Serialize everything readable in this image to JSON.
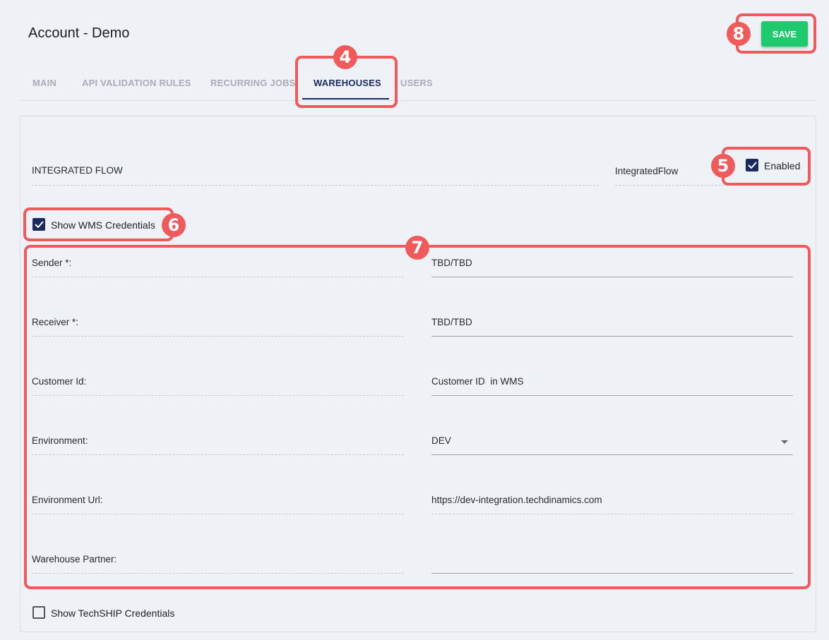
{
  "header": {
    "title": "Account - Demo",
    "save_label": "SAVE"
  },
  "tabs": [
    {
      "label": "MAIN",
      "active": false
    },
    {
      "label": "API VALIDATION RULES",
      "active": false
    },
    {
      "label": "RECURRING JOBS",
      "active": false
    },
    {
      "label": "WAREHOUSES",
      "active": true
    },
    {
      "label": "USERS",
      "active": false
    }
  ],
  "integrated_flow": {
    "label": "INTEGRATED FLOW",
    "value": "IntegratedFlow",
    "enabled_label": "Enabled",
    "enabled": true
  },
  "wms_toggle": {
    "label": "Show WMS Credentials",
    "checked": true
  },
  "wms_fields": [
    {
      "label": "Sender *:",
      "value": "TBD/TBD"
    },
    {
      "label": "Receiver *:",
      "value": "TBD/TBD"
    },
    {
      "label": "Customer Id:",
      "value": "Customer ID  in WMS"
    },
    {
      "label": "Environment:",
      "value": "DEV"
    },
    {
      "label": "Environment Url:",
      "value": "https://dev-integration.techdinamics.com"
    },
    {
      "label": "Warehouse Partner:",
      "value": ""
    }
  ],
  "techship_toggle": {
    "label": "Show TechSHIP Credentials",
    "checked": false
  },
  "annotations": [
    "4",
    "5",
    "6",
    "7",
    "8"
  ],
  "colors": {
    "accent": "#1b2a5c",
    "save": "#1fca6f",
    "highlight": "#f05a5a"
  }
}
